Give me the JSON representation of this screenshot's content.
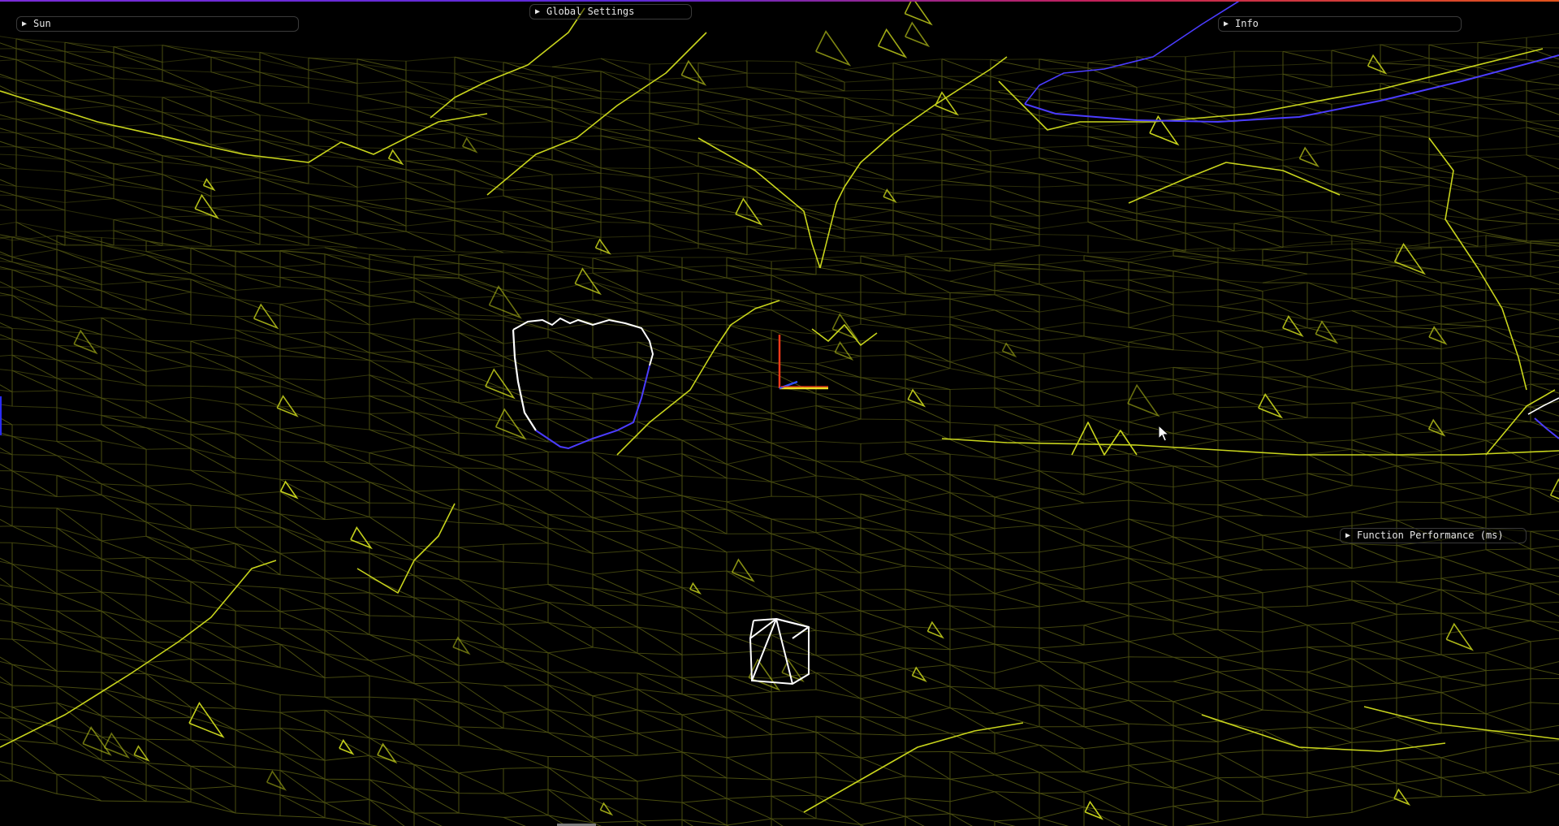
{
  "panels": {
    "sun": {
      "label": "Sun",
      "collapsed": true,
      "arrow_icon": "triangle-right-icon"
    },
    "global_settings": {
      "label": "Global Settings",
      "collapsed": true,
      "arrow_icon": "triangle-right-icon"
    },
    "info": {
      "label": "Info",
      "collapsed": true,
      "arrow_icon": "triangle-right-icon"
    },
    "function_performance": {
      "label": "Function Performance (ms)",
      "collapsed": true,
      "arrow_icon": "triangle-right-icon"
    }
  },
  "scene": {
    "render_mode": "wireframe",
    "mesh_color": "#c8d41c",
    "mesh_dim_color": "#4a4e10",
    "outline_color": "#ffffff",
    "outline_accent_color": "#4b3cff",
    "background_color": "#000000",
    "gizmo_colors": {
      "x": "#ff3b1a",
      "y": "#f0e020",
      "z": "#3050ff"
    }
  },
  "colors": {
    "panel_text": "#e6e6e6",
    "panel_border": "#3a3a3a",
    "edge_accent_left": "#2a2cff"
  }
}
